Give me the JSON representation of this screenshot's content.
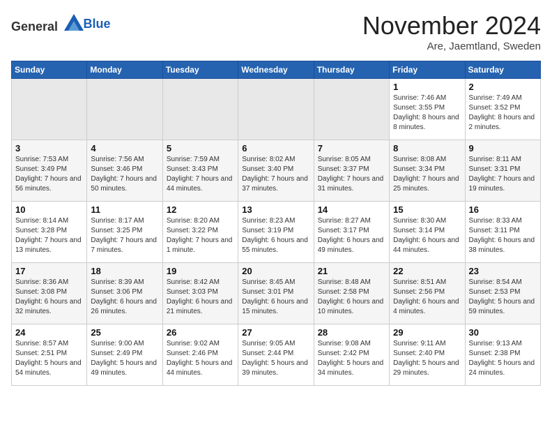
{
  "header": {
    "logo_general": "General",
    "logo_blue": "Blue",
    "month_title": "November 2024",
    "location": "Are, Jaemtland, Sweden"
  },
  "weekdays": [
    "Sunday",
    "Monday",
    "Tuesday",
    "Wednesday",
    "Thursday",
    "Friday",
    "Saturday"
  ],
  "weeks": [
    [
      {
        "day": "",
        "detail": ""
      },
      {
        "day": "",
        "detail": ""
      },
      {
        "day": "",
        "detail": ""
      },
      {
        "day": "",
        "detail": ""
      },
      {
        "day": "",
        "detail": ""
      },
      {
        "day": "1",
        "detail": "Sunrise: 7:46 AM\nSunset: 3:55 PM\nDaylight: 8 hours\nand 8 minutes."
      },
      {
        "day": "2",
        "detail": "Sunrise: 7:49 AM\nSunset: 3:52 PM\nDaylight: 8 hours\nand 2 minutes."
      }
    ],
    [
      {
        "day": "3",
        "detail": "Sunrise: 7:53 AM\nSunset: 3:49 PM\nDaylight: 7 hours\nand 56 minutes."
      },
      {
        "day": "4",
        "detail": "Sunrise: 7:56 AM\nSunset: 3:46 PM\nDaylight: 7 hours\nand 50 minutes."
      },
      {
        "day": "5",
        "detail": "Sunrise: 7:59 AM\nSunset: 3:43 PM\nDaylight: 7 hours\nand 44 minutes."
      },
      {
        "day": "6",
        "detail": "Sunrise: 8:02 AM\nSunset: 3:40 PM\nDaylight: 7 hours\nand 37 minutes."
      },
      {
        "day": "7",
        "detail": "Sunrise: 8:05 AM\nSunset: 3:37 PM\nDaylight: 7 hours\nand 31 minutes."
      },
      {
        "day": "8",
        "detail": "Sunrise: 8:08 AM\nSunset: 3:34 PM\nDaylight: 7 hours\nand 25 minutes."
      },
      {
        "day": "9",
        "detail": "Sunrise: 8:11 AM\nSunset: 3:31 PM\nDaylight: 7 hours\nand 19 minutes."
      }
    ],
    [
      {
        "day": "10",
        "detail": "Sunrise: 8:14 AM\nSunset: 3:28 PM\nDaylight: 7 hours\nand 13 minutes."
      },
      {
        "day": "11",
        "detail": "Sunrise: 8:17 AM\nSunset: 3:25 PM\nDaylight: 7 hours\nand 7 minutes."
      },
      {
        "day": "12",
        "detail": "Sunrise: 8:20 AM\nSunset: 3:22 PM\nDaylight: 7 hours\nand 1 minute."
      },
      {
        "day": "13",
        "detail": "Sunrise: 8:23 AM\nSunset: 3:19 PM\nDaylight: 6 hours\nand 55 minutes."
      },
      {
        "day": "14",
        "detail": "Sunrise: 8:27 AM\nSunset: 3:17 PM\nDaylight: 6 hours\nand 49 minutes."
      },
      {
        "day": "15",
        "detail": "Sunrise: 8:30 AM\nSunset: 3:14 PM\nDaylight: 6 hours\nand 44 minutes."
      },
      {
        "day": "16",
        "detail": "Sunrise: 8:33 AM\nSunset: 3:11 PM\nDaylight: 6 hours\nand 38 minutes."
      }
    ],
    [
      {
        "day": "17",
        "detail": "Sunrise: 8:36 AM\nSunset: 3:08 PM\nDaylight: 6 hours\nand 32 minutes."
      },
      {
        "day": "18",
        "detail": "Sunrise: 8:39 AM\nSunset: 3:06 PM\nDaylight: 6 hours\nand 26 minutes."
      },
      {
        "day": "19",
        "detail": "Sunrise: 8:42 AM\nSunset: 3:03 PM\nDaylight: 6 hours\nand 21 minutes."
      },
      {
        "day": "20",
        "detail": "Sunrise: 8:45 AM\nSunset: 3:01 PM\nDaylight: 6 hours\nand 15 minutes."
      },
      {
        "day": "21",
        "detail": "Sunrise: 8:48 AM\nSunset: 2:58 PM\nDaylight: 6 hours\nand 10 minutes."
      },
      {
        "day": "22",
        "detail": "Sunrise: 8:51 AM\nSunset: 2:56 PM\nDaylight: 6 hours\nand 4 minutes."
      },
      {
        "day": "23",
        "detail": "Sunrise: 8:54 AM\nSunset: 2:53 PM\nDaylight: 5 hours\nand 59 minutes."
      }
    ],
    [
      {
        "day": "24",
        "detail": "Sunrise: 8:57 AM\nSunset: 2:51 PM\nDaylight: 5 hours\nand 54 minutes."
      },
      {
        "day": "25",
        "detail": "Sunrise: 9:00 AM\nSunset: 2:49 PM\nDaylight: 5 hours\nand 49 minutes."
      },
      {
        "day": "26",
        "detail": "Sunrise: 9:02 AM\nSunset: 2:46 PM\nDaylight: 5 hours\nand 44 minutes."
      },
      {
        "day": "27",
        "detail": "Sunrise: 9:05 AM\nSunset: 2:44 PM\nDaylight: 5 hours\nand 39 minutes."
      },
      {
        "day": "28",
        "detail": "Sunrise: 9:08 AM\nSunset: 2:42 PM\nDaylight: 5 hours\nand 34 minutes."
      },
      {
        "day": "29",
        "detail": "Sunrise: 9:11 AM\nSunset: 2:40 PM\nDaylight: 5 hours\nand 29 minutes."
      },
      {
        "day": "30",
        "detail": "Sunrise: 9:13 AM\nSunset: 2:38 PM\nDaylight: 5 hours\nand 24 minutes."
      }
    ]
  ]
}
